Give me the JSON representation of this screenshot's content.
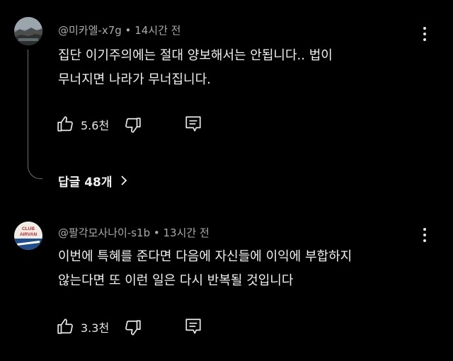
{
  "comments": [
    {
      "author": "@미카엘-x7g",
      "separator": "•",
      "time": "14시간 전",
      "lines": [
        "집단 이기주의에는 절대 양보해서는 안됩니다.. 법이",
        "무너지면 나라가 무너집니다."
      ],
      "likes": "5.6천",
      "replies_label": "답글 48개",
      "avatar_icon": "landscape-avatar"
    },
    {
      "author": "@팔각모사나이-s1b",
      "separator": "•",
      "time": "13시간 전",
      "lines": [
        "이번에 특혜를 준다면 다음에 자신들에 이익에 부합하지",
        "않는다면 또 이런 일은 다시 반복될 것입니다"
      ],
      "likes": "3.3천",
      "avatar_icon": "club-airvan-badge-avatar",
      "avatar_text": [
        "CLUB",
        "AIRVAN"
      ]
    }
  ],
  "colors": {
    "background": "#000000",
    "text": "#f1f1f1",
    "meta": "#aaaaaa",
    "thread_line": "#6e6e6e"
  }
}
